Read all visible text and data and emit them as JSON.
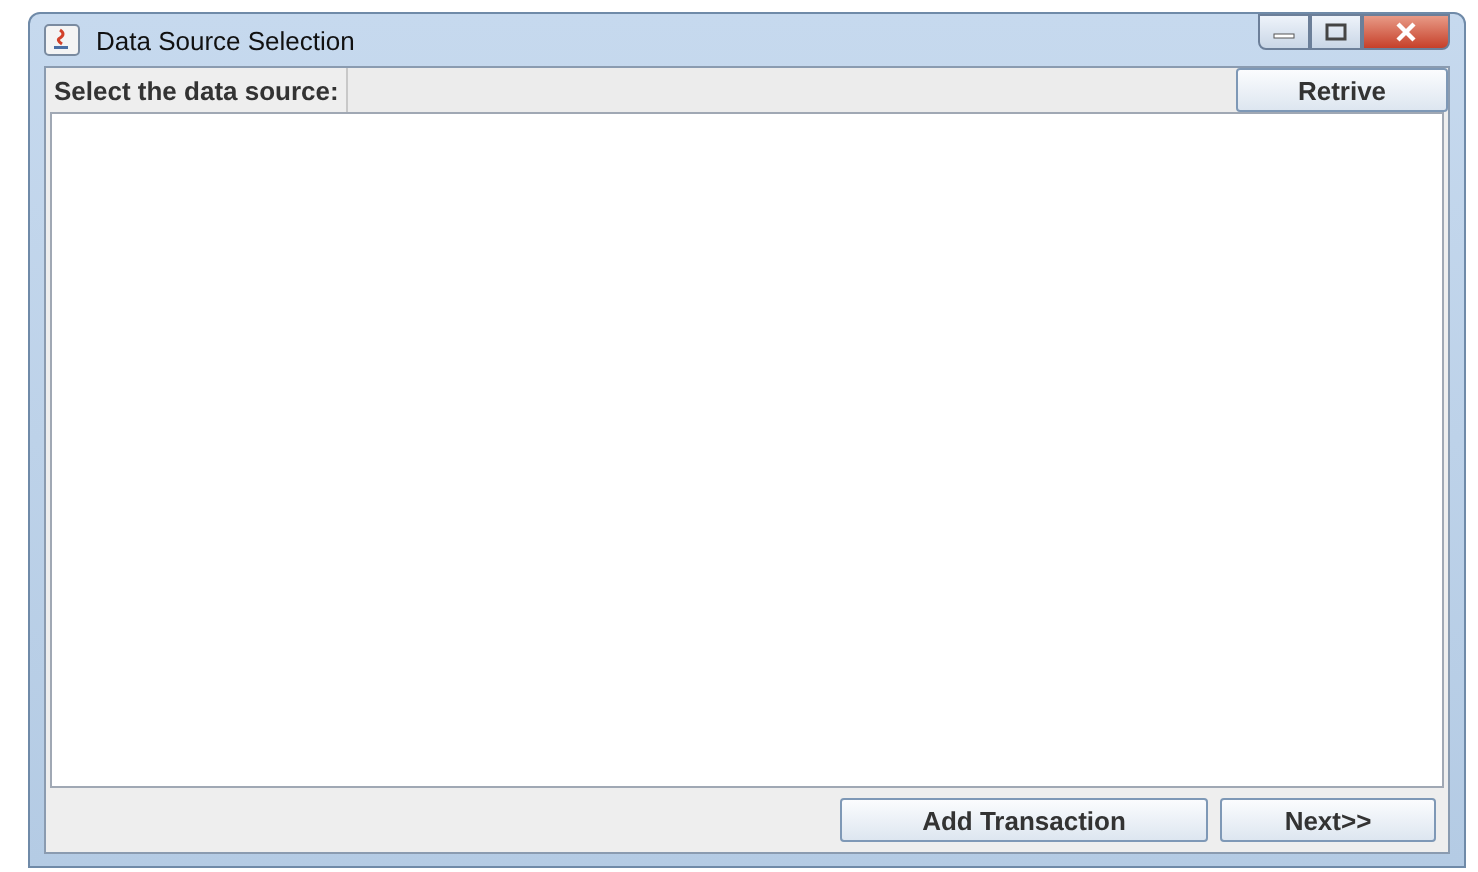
{
  "window": {
    "title": "Data Source Selection"
  },
  "source_row": {
    "label": "Select the data source:",
    "button": "Retrive"
  },
  "buttons": [
    {
      "label": "Add Transaction"
    },
    {
      "label": "Next>>"
    }
  ]
}
